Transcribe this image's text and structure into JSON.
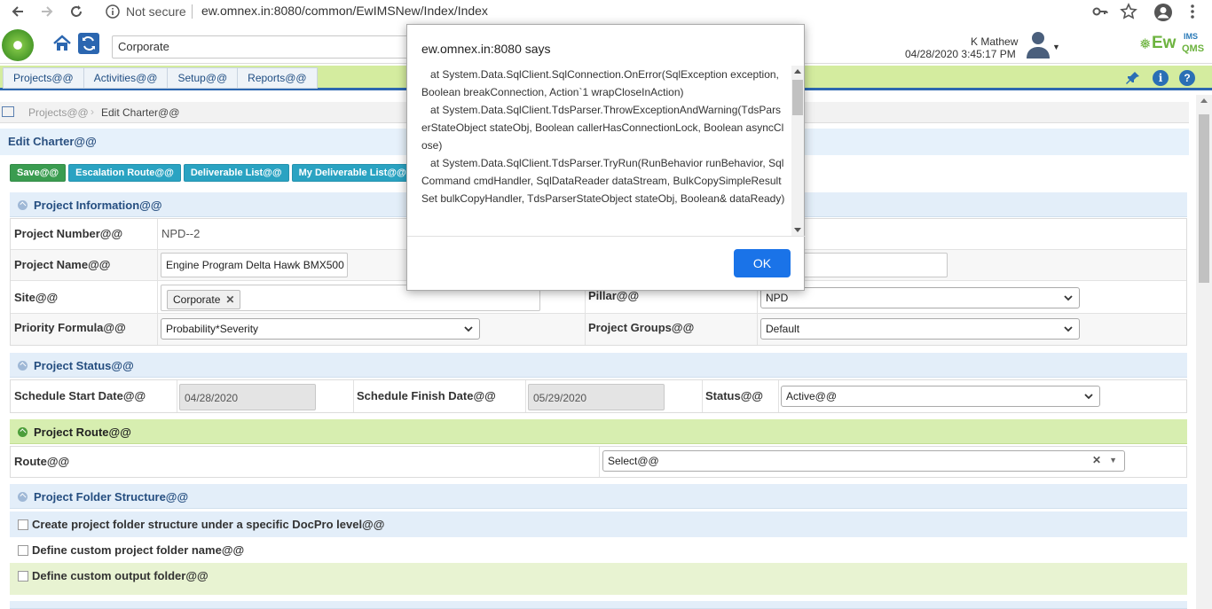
{
  "browser": {
    "not_secure": "Not secure",
    "url": "ew.omnex.in:8080/common/EwIMSNew/Index/Index"
  },
  "header": {
    "site_value": "Corporate",
    "user_name": "K Mathew",
    "datetime": "04/28/2020 3:45:17 PM",
    "brand_ew": "Ew",
    "brand_ims": "IMS",
    "brand_qms": "QMS"
  },
  "menu": {
    "items": [
      {
        "label": "Projects@@"
      },
      {
        "label": "Activities@@"
      },
      {
        "label": "Setup@@"
      },
      {
        "label": "Reports@@"
      }
    ]
  },
  "breadcrumb": {
    "parent": "Projects@@",
    "current": "Edit Charter@@"
  },
  "page": {
    "title": "Edit Charter@@"
  },
  "toolbar": {
    "save": "Save@@",
    "escalation": "Escalation Route@@",
    "deliverables": "Deliverable List@@",
    "my_deliverables": "My Deliverable List@@"
  },
  "project_info": {
    "section_title": "Project Information@@",
    "number_label": "Project Number@@",
    "number_value": "NPD--2",
    "name_label": "Project Name@@",
    "name_value": "Engine Program Delta Hawk BMX500",
    "site_label": "Site@@",
    "site_tag": "Corporate",
    "pillar_label": "Pillar@@",
    "pillar_value": "NPD",
    "priority_label": "Priority Formula@@",
    "priority_value": "Probability*Severity",
    "groups_label": "Project Groups@@",
    "groups_value": "Default"
  },
  "project_status": {
    "section_title": "Project Status@@",
    "start_label": "Schedule Start Date@@",
    "start_value": "04/28/2020",
    "finish_label": "Schedule Finish Date@@",
    "finish_value": "05/29/2020",
    "status_label": "Status@@",
    "status_value": "Active@@"
  },
  "project_route": {
    "section_title": "Project Route@@",
    "route_label": "Route@@",
    "route_value": "Select@@"
  },
  "folder_structure": {
    "section_title": "Project Folder Structure@@",
    "options": [
      {
        "label": "Create project folder structure under a specific DocPro level@@"
      },
      {
        "label": "Define custom project folder name@@"
      },
      {
        "label": "Define custom output folder@@"
      }
    ]
  },
  "dialog": {
    "title": "ew.omnex.in:8080 says",
    "lines": [
      "   at System.Data.SqlClient.SqlConnection.OnError(SqlException exception, Boolean breakConnection, Action`1 wrapCloseInAction)",
      "   at System.Data.SqlClient.TdsParser.ThrowExceptionAndWarning(TdsParserStateObject stateObj, Boolean callerHasConnectionLock, Boolean asyncClose)",
      "   at System.Data.SqlClient.TdsParser.TryRun(RunBehavior runBehavior, SqlCommand cmdHandler, SqlDataReader dataStream, BulkCopySimpleResultSet bulkCopyHandler, TdsParserStateObject stateObj, Boolean& dataReady)"
    ],
    "ok": "OK"
  }
}
